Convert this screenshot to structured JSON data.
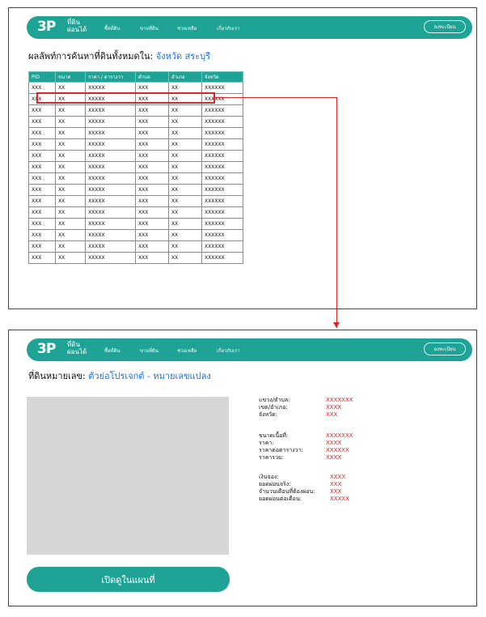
{
  "nav": {
    "logo_mark": "3P",
    "logo_line1": "ที่ดิน",
    "logo_line2": "ผ่อนได้",
    "items": [
      "ซื้อที่ดิน",
      "ขายที่ดิน",
      "ช่วยเหลือ",
      "เกี่ยวกับเรา"
    ],
    "register": "ลงทะเบียน"
  },
  "results": {
    "title_prefix": "ผลลัพท์การค้นหาที่ดินทั้งหมดใน:",
    "title_location": "จังหวัด สระบุรี",
    "columns": [
      "PID",
      "ขนาด",
      "ราคา / ตารางวา",
      "ตำบล",
      "อำเภอ",
      "จังหวัด"
    ],
    "rows": [
      [
        "XXX",
        "XX",
        "XXXXX",
        "XXX",
        "XX",
        "XXXXXX"
      ],
      [
        "XXX",
        "XX",
        "XXXXX",
        "XXX",
        "XX",
        "XXXXXX"
      ],
      [
        "XXX",
        "XX",
        "XXXXX",
        "XXX",
        "XX",
        "XXXXXX"
      ],
      [
        "XXX",
        "XX",
        "XXXXX",
        "XXX",
        "XX",
        "XXXXXX"
      ],
      [
        "XXX",
        "XX",
        "XXXXX",
        "XXX",
        "XX",
        "XXXXXX"
      ],
      [
        "XXX",
        "XX",
        "XXXXX",
        "XXX",
        "XX",
        "XXXXXX"
      ],
      [
        "XXX",
        "XX",
        "XXXXX",
        "XXX",
        "XX",
        "XXXXXX"
      ],
      [
        "XXX",
        "XX",
        "XXXXX",
        "XXX",
        "XX",
        "XXXXXX"
      ],
      [
        "XXX",
        "XX",
        "XXXXX",
        "XXX",
        "XX",
        "XXXXXX"
      ],
      [
        "XXX",
        "XX",
        "XXXXX",
        "XXX",
        "XX",
        "XXXXXX"
      ],
      [
        "XXX",
        "XX",
        "XXXXX",
        "XXX",
        "XX",
        "XXXXXX"
      ],
      [
        "XXX",
        "XX",
        "XXXXX",
        "XXX",
        "XX",
        "XXXXXX"
      ],
      [
        "XXX",
        "XX",
        "XXXXX",
        "XXX",
        "XX",
        "XXXXXX"
      ],
      [
        "XXX",
        "XX",
        "XXXXX",
        "XXX",
        "XX",
        "XXXXXX"
      ],
      [
        "XXX",
        "XX",
        "XXXXX",
        "XXX",
        "XX",
        "XXXXXX"
      ],
      [
        "XXX",
        "XX",
        "XXXXX",
        "XXX",
        "XX",
        "XXXXXX"
      ]
    ]
  },
  "detail": {
    "title_prefix": "ที่ดินหมายเลข:",
    "title_value": "ตัวย่อโปรเจกต์ - หมายเลขแปลง",
    "map_button": "เปิดดูในแผนที่",
    "location": [
      {
        "label": "แขวง/ตำบล:",
        "value": "XXXXXXX"
      },
      {
        "label": "เขต/อำเภอ:",
        "value": "XXXX"
      },
      {
        "label": "จังหวัด:",
        "value": "XXX"
      }
    ],
    "pricing": [
      {
        "label": "ขนาดเนื้อที่:",
        "value": "XXXXXXX"
      },
      {
        "label": "ราคา:",
        "value": "XXXX"
      },
      {
        "label": "ราคาต่อตารางวา:",
        "value": "XXXXXX"
      },
      {
        "label": "ราคารวม:",
        "value": "XXXX"
      }
    ],
    "payment": [
      {
        "label": "เงินจอง:",
        "value": "XXXX"
      },
      {
        "label": "ยอดผ่อนจริง:",
        "value": "XXX"
      },
      {
        "label": "จำนวนเดือนที่ต้องผ่อน:",
        "value": "XXX"
      },
      {
        "label": "ยอดผ่อนต่อเดือน:",
        "value": "XXXXX"
      }
    ]
  },
  "colors": {
    "primary": "#1fa396",
    "accent": "#1a73e8",
    "highlight": "#e02323"
  }
}
